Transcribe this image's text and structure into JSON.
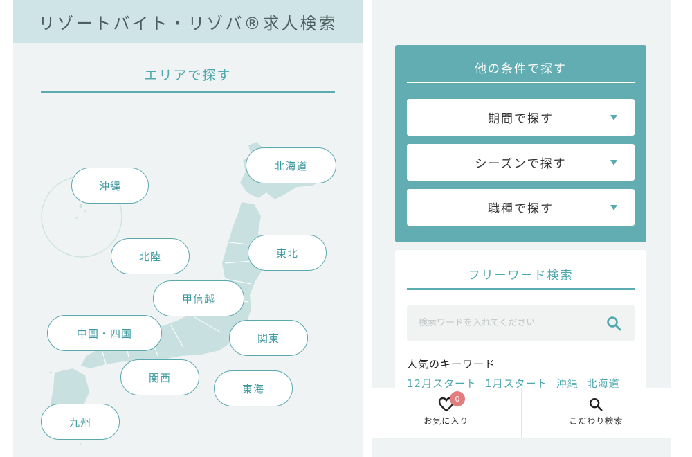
{
  "left": {
    "site_title": "リゾートバイト・リゾバ®求人検索",
    "area_heading": "エリアで探す",
    "regions": {
      "okinawa": "沖縄",
      "hokkaido": "北海道",
      "hokuriku": "北陸",
      "tohoku": "東北",
      "koshinetsu": "甲信越",
      "chugoku_shikoku": "中国・四国",
      "kanto": "関東",
      "kansai": "関西",
      "tokai": "東海",
      "kyushu": "九州"
    }
  },
  "right": {
    "condition_heading": "他の条件で探す",
    "condition_buttons": {
      "period": "期間で探す",
      "season": "シーズンで探す",
      "job_type": "職種で探す"
    },
    "freeword_heading": "フリーワード検索",
    "search_placeholder": "検索ワードを入れてください",
    "popular_label": "人気のキーワード",
    "keywords": [
      "12月スタート",
      "1月スタート",
      "沖縄",
      "北海道"
    ]
  },
  "bottom_nav": {
    "favorites_label": "お気に入り",
    "favorites_count": "0",
    "advanced_search_label": "こだわり検索"
  },
  "colors": {
    "accent": "#5aa9ae",
    "badge": "#e37c7c",
    "header_bg": "#cfe4e6",
    "map_fill": "#c8e1e0"
  }
}
